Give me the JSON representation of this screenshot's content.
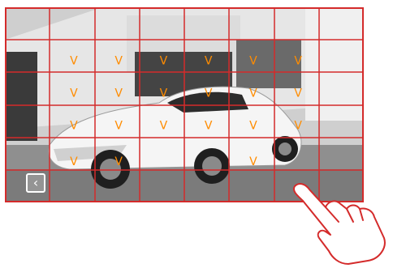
{
  "grid": {
    "columns": 8,
    "rows": 6,
    "line_color": "#d42b2b"
  },
  "marker": {
    "text": "V",
    "color": "#ff8c00"
  },
  "markers": [
    {
      "row": 1,
      "col": 1
    },
    {
      "row": 1,
      "col": 2
    },
    {
      "row": 1,
      "col": 3
    },
    {
      "row": 1,
      "col": 4
    },
    {
      "row": 1,
      "col": 5
    },
    {
      "row": 1,
      "col": 6
    },
    {
      "row": 2,
      "col": 1
    },
    {
      "row": 2,
      "col": 2
    },
    {
      "row": 2,
      "col": 3
    },
    {
      "row": 2,
      "col": 4
    },
    {
      "row": 2,
      "col": 5
    },
    {
      "row": 2,
      "col": 6
    },
    {
      "row": 3,
      "col": 1
    },
    {
      "row": 3,
      "col": 2
    },
    {
      "row": 3,
      "col": 3
    },
    {
      "row": 3,
      "col": 4
    },
    {
      "row": 3,
      "col": 5
    },
    {
      "row": 3,
      "col": 6
    },
    {
      "row": 4,
      "col": 1
    },
    {
      "row": 4,
      "col": 2
    },
    {
      "row": 4,
      "col": 5
    }
  ],
  "icons": {
    "back": "chevron-left-icon",
    "gesture": "tapping-hand-icon"
  },
  "back_glyph": "‹"
}
